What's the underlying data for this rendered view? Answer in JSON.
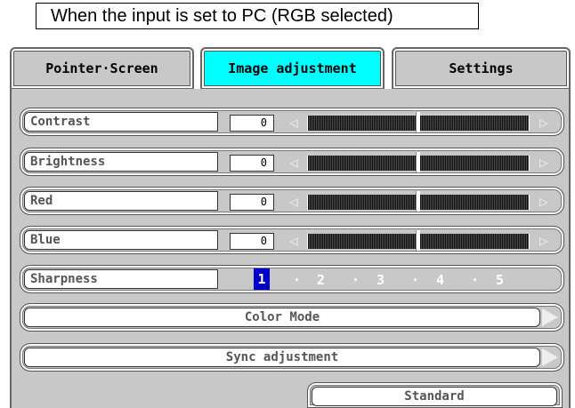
{
  "caption": "When the input is set to PC (RGB selected)",
  "tabs": [
    {
      "label": "Pointer·Screen",
      "active": false
    },
    {
      "label": "Image adjustment",
      "active": true
    },
    {
      "label": "Settings",
      "active": false
    }
  ],
  "sliders": [
    {
      "label": "Contrast",
      "value": "0"
    },
    {
      "label": "Brightness",
      "value": "0"
    },
    {
      "label": "Red",
      "value": "0"
    },
    {
      "label": "Blue",
      "value": "0"
    }
  ],
  "sharpness": {
    "label": "Sharpness",
    "levels": [
      "1",
      "2",
      "3",
      "4",
      "5"
    ],
    "selected": "1"
  },
  "color_mode_label": "Color Mode",
  "sync_label": "Sync adjustment",
  "standard_label": "Standard",
  "colors": {
    "active_tab": "#00ffff",
    "panel": "#c8c8c8",
    "sharpness_selected": "#0000cc"
  }
}
